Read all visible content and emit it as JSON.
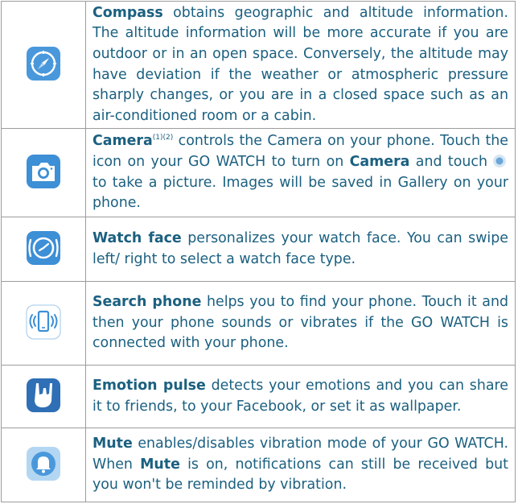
{
  "colors": {
    "text": "#1b6080",
    "icon_blue": "#3d8fd6",
    "border": "#9c9c9c"
  },
  "rows": [
    {
      "icon": "compass-icon",
      "title": "Compass",
      "text": " obtains geographic and altitude information. The altitude information will be more accurate if you are outdoor or in an open space. Conversely, the altitude may have deviation if the weather or atmospheric pressure sharply changes, or you are in a closed space such as an air-conditioned room or a cabin."
    },
    {
      "icon": "camera-icon",
      "title": "Camera",
      "sup": "(1)(2)",
      "text_a": " controls the Camera on your phone. Touch the icon on your GO WATCH to turn on ",
      "title2": "Camera",
      "text_b": " and touch",
      "inline_icon": "shutter-icon",
      "text_c": " to take a picture. Images will be saved in Gallery on your phone."
    },
    {
      "icon": "watch-face-icon",
      "title": "Watch face",
      "text": " personalizes your watch face. You can swipe left/ right to select a watch face type."
    },
    {
      "icon": "search-phone-icon",
      "title": "Search phone",
      "text": " helps you to find your phone. Touch it and then your phone sounds or vibrates if the GO WATCH is connected with your phone."
    },
    {
      "icon": "rock-hand-icon",
      "title": "Emotion pulse",
      "text": " detects your emotions and you can share it to friends, to your Facebook, or set it as wallpaper."
    },
    {
      "icon": "bell-icon",
      "title": "Mute",
      "text_a": " enables/disables vibration mode of your GO WATCH. When ",
      "title2": "Mute",
      "text_b": " is on, notifications can still be received but you won't be reminded by vibration."
    }
  ]
}
